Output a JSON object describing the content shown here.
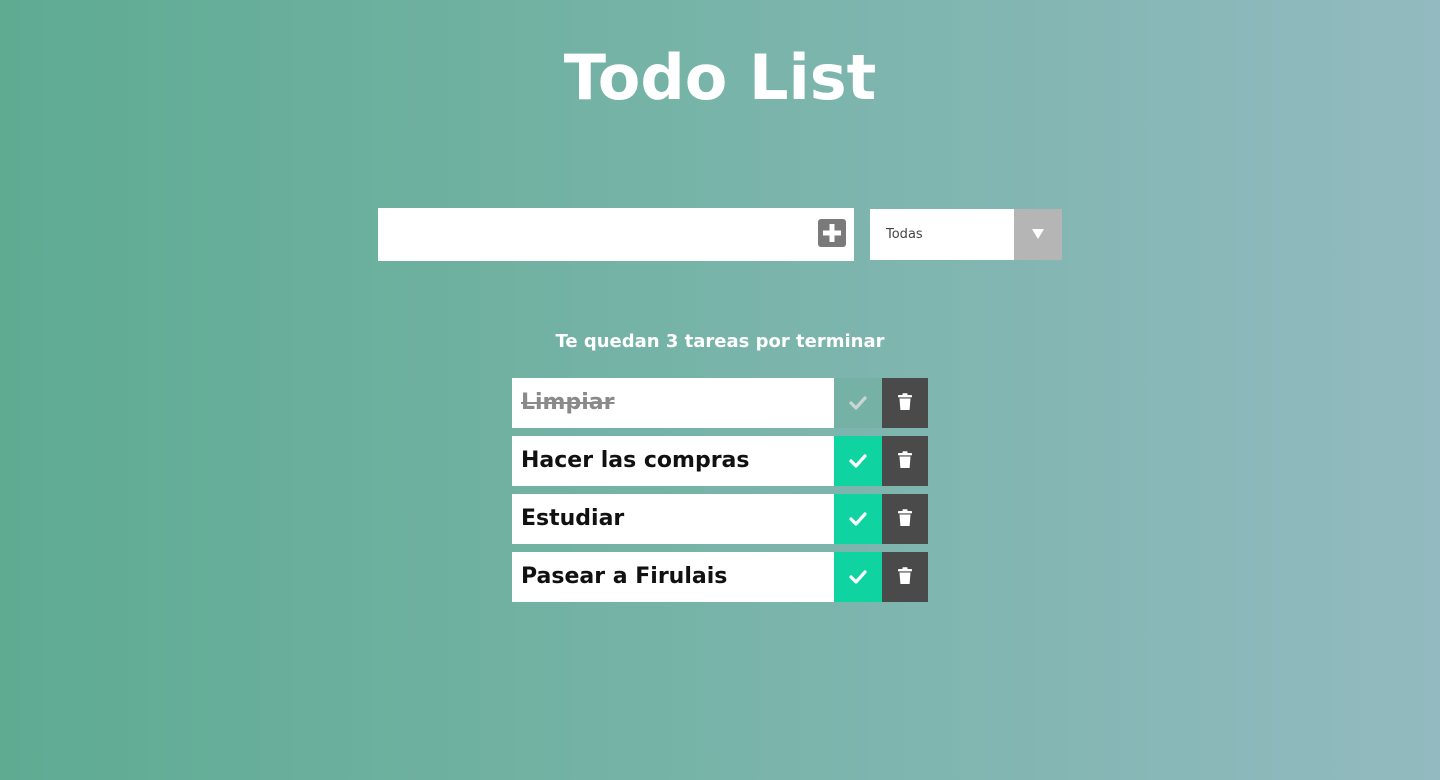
{
  "header": {
    "title": "Todo List"
  },
  "form": {
    "input_value": "",
    "input_placeholder": "",
    "add_icon": "plus-icon",
    "filter": {
      "selected": "Todas",
      "arrow_icon": "triangle-down-icon"
    }
  },
  "status": {
    "pending_text": "Te quedan 3 tareas por terminar"
  },
  "todos": [
    {
      "text": "Limpiar",
      "completed": true
    },
    {
      "text": "Hacer las compras",
      "completed": false
    },
    {
      "text": "Estudiar",
      "completed": false
    },
    {
      "text": "Pasear a Firulais",
      "completed": false
    }
  ],
  "icons": {
    "complete": "check-icon",
    "delete": "trash-icon"
  },
  "colors": {
    "complete_active": "#0fd4a2",
    "complete_done": "#75b2a5",
    "delete": "#4a4a4a",
    "filter_arrow_bg": "#b5b5b5",
    "add_button_bg": "#7a7a7a"
  }
}
